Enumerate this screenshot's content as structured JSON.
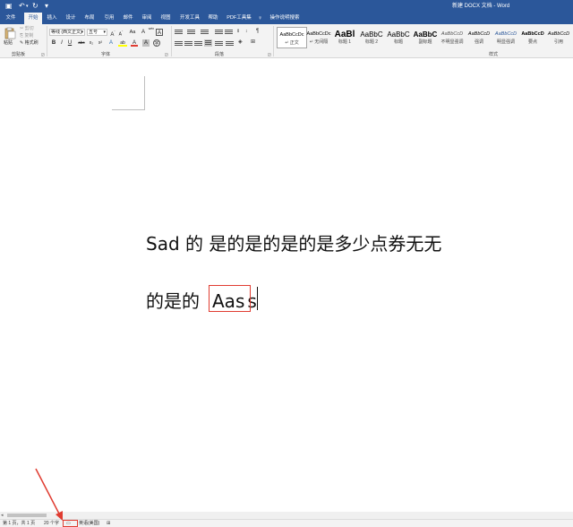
{
  "titlebar": {
    "doc_title": "新建 DOCX 文档 - Word",
    "save_icon": "save-icon",
    "undo_icon": "undo-icon",
    "redo_icon": "redo-icon",
    "save_symbol": "▣",
    "undo_symbol": "↶",
    "undo_dd": "▾",
    "redo_symbol": "↻",
    "customize_symbol": "▾"
  },
  "tabs": [
    {
      "label": "文件"
    },
    {
      "label": "开始"
    },
    {
      "label": "插入"
    },
    {
      "label": "设计"
    },
    {
      "label": "布局"
    },
    {
      "label": "引用"
    },
    {
      "label": "邮件"
    },
    {
      "label": "审阅"
    },
    {
      "label": "视图"
    },
    {
      "label": "开发工具"
    },
    {
      "label": "帮助"
    },
    {
      "label": "PDF工具集"
    }
  ],
  "tell_me": {
    "label": "操作说明搜索",
    "icon": "lightbulb-icon",
    "symbol": "♀"
  },
  "ribbon": {
    "clipboard": {
      "label": "剪贴板",
      "paste": "粘贴",
      "cut": "剪切",
      "copy": "复制",
      "format_painter": "格式刷"
    },
    "font": {
      "label": "字体",
      "font_name": "等线 (西文正文)",
      "font_size": "五号",
      "dropdown": "▾",
      "grow": "A",
      "grow_marker": "ˆ",
      "shrink": "A",
      "shrink_marker": "ˇ",
      "change_case": "Aa",
      "clear": "A",
      "phonetic": "wén",
      "border": "A",
      "bold": "B",
      "italic": "I",
      "underline": "U",
      "strike": "abc",
      "sub": "x₂",
      "sup": "x²",
      "effects": "A",
      "highlight": "ab",
      "color": "A",
      "shade": "A",
      "enclose": "字",
      "highlight_color": "#ffff00",
      "font_color": "#e03c31"
    },
    "paragraph": {
      "label": "段落"
    },
    "styles": {
      "label": "样式",
      "items": [
        {
          "preview": "AaBbCcDc",
          "name": "↵ 正文"
        },
        {
          "preview": "AaBbCcDc",
          "name": "↵ 无间隔"
        },
        {
          "preview": "AaBl",
          "name": "标题 1"
        },
        {
          "preview": "AaBbC",
          "name": "标题 2"
        },
        {
          "preview": "AaBbC",
          "name": "标题"
        },
        {
          "preview": "AaBbC",
          "name": "副标题"
        },
        {
          "preview": "AaBbCcD",
          "name": "不明显强调"
        },
        {
          "preview": "AaBbCcD",
          "name": "强调"
        },
        {
          "preview": "AaBbCcD",
          "name": "明显强调"
        },
        {
          "preview": "AaBbCcD",
          "name": "要点"
        },
        {
          "preview": "AaBbCcD",
          "name": "引用"
        }
      ]
    }
  },
  "document": {
    "line1": "Sad 的  是的是的是的是多少点券无无",
    "line2_prefix": "的是的",
    "line2_boxed": "Aas",
    "line2_suffix": "s"
  },
  "statusbar": {
    "page": "第 1 页，共 1 页",
    "words": "20 个字",
    "proofing_icon": "proofing-icon",
    "proofing_symbol": "▭",
    "language": "英语(美国)",
    "macro_icon": "macro-record-icon",
    "macro_symbol": "⊞"
  },
  "scrollbar": {
    "left_arrow": "◂"
  },
  "colors": {
    "title_blue": "#2b579a",
    "annotation_red": "#e03c31"
  }
}
